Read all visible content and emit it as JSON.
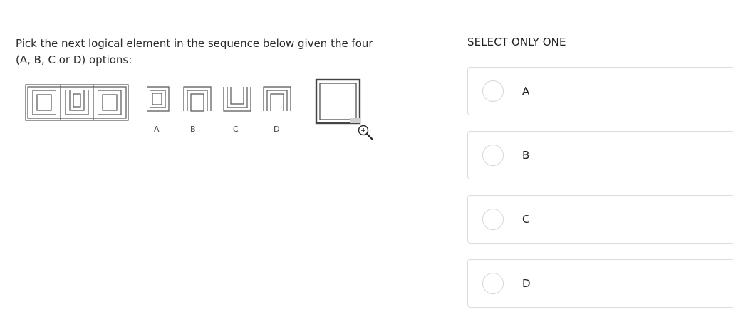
{
  "question": {
    "text": "Pick the next logical element in the sequence below given the four (A, B, C or D) options:"
  },
  "figure": {
    "option_letters": [
      "A",
      "B",
      "C",
      "D"
    ],
    "zoom_icon": "zoom-in-icon"
  },
  "answers": {
    "instruction": "SELECT ONLY ONE",
    "options": [
      {
        "label": "A"
      },
      {
        "label": "B"
      },
      {
        "label": "C"
      },
      {
        "label": "D"
      }
    ]
  },
  "colors": {
    "text": "#222222",
    "figure_stroke": "#555555",
    "border": "#dcdcdc"
  }
}
